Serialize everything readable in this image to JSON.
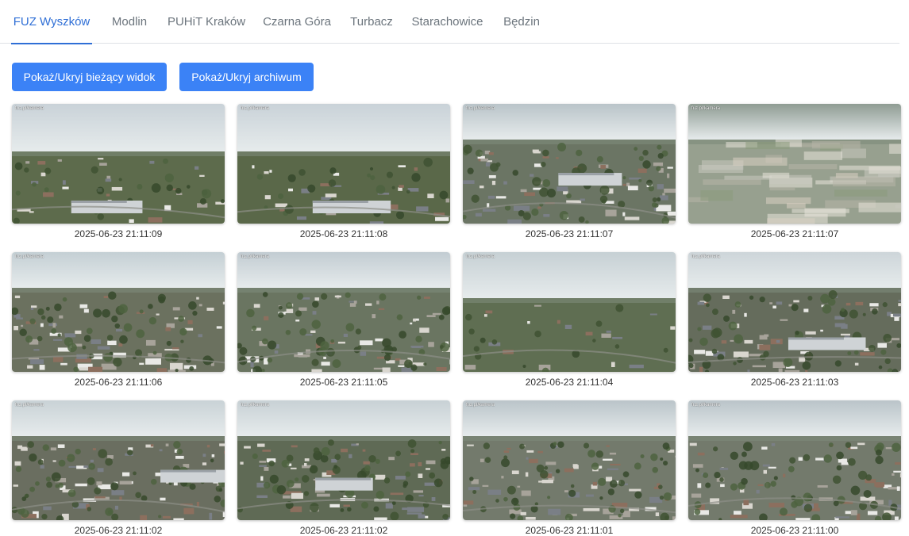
{
  "tabs": [
    {
      "label": "FUZ Wyszków",
      "active": true
    },
    {
      "label": "Modlin",
      "active": false
    },
    {
      "label": "PUHiT Kraków",
      "active": false
    },
    {
      "label": "Czarna Góra",
      "active": false
    },
    {
      "label": "Turbacz",
      "active": false
    },
    {
      "label": "Starachowice",
      "active": false
    },
    {
      "label": "Będzin",
      "active": false
    }
  ],
  "buttons": {
    "toggle_current": "Pokaż/Ukryj bieżący widok",
    "toggle_archive": "Pokaż/Ukryj archiwum"
  },
  "watermark": "fuz.pl/kamera",
  "colors": {
    "accent": "#2f6fd6",
    "button": "#3b82f6"
  },
  "cameras": [
    {
      "timestamp": "2025-06-23 21:11:09",
      "scene": "panorama-low",
      "sky": "#c9d2d8",
      "ground": "#5d6b4c"
    },
    {
      "timestamp": "2025-06-23 21:11:08",
      "scene": "panorama-low",
      "sky": "#c9d2d8",
      "ground": "#5a6849"
    },
    {
      "timestamp": "2025-06-23 21:11:07",
      "scene": "town-close",
      "sky": "#b9c4c9",
      "ground": "#6b7564"
    },
    {
      "timestamp": "2025-06-23 21:11:07",
      "scene": "blurred",
      "sky": "#8f9c93",
      "ground": "#97a08f"
    },
    {
      "timestamp": "2025-06-23 21:11:06",
      "scene": "town",
      "sky": "#c4cfd4",
      "ground": "#6b715f"
    },
    {
      "timestamp": "2025-06-23 21:11:05",
      "scene": "town",
      "sky": "#c2ccd2",
      "ground": "#6a7561"
    },
    {
      "timestamp": "2025-06-23 21:11:04",
      "scene": "fields",
      "sky": "#c6d0d4",
      "ground": "#5f6e52"
    },
    {
      "timestamp": "2025-06-23 21:11:03",
      "scene": "industrial",
      "sky": "#cdd5d9",
      "ground": "#656c5c"
    },
    {
      "timestamp": "2025-06-23 21:11:02",
      "scene": "industrial",
      "sky": "#c9d2d6",
      "ground": "#6a6e60"
    },
    {
      "timestamp": "2025-06-23 21:11:02",
      "scene": "industrial",
      "sky": "#c8d1d5",
      "ground": "#5f6a55"
    },
    {
      "timestamp": "2025-06-23 21:11:01",
      "scene": "town",
      "sky": "#bac4c9",
      "ground": "#737a6c"
    },
    {
      "timestamp": "2025-06-23 21:11:00",
      "scene": "town",
      "sky": "#bac4c9",
      "ground": "#737a6c"
    }
  ]
}
